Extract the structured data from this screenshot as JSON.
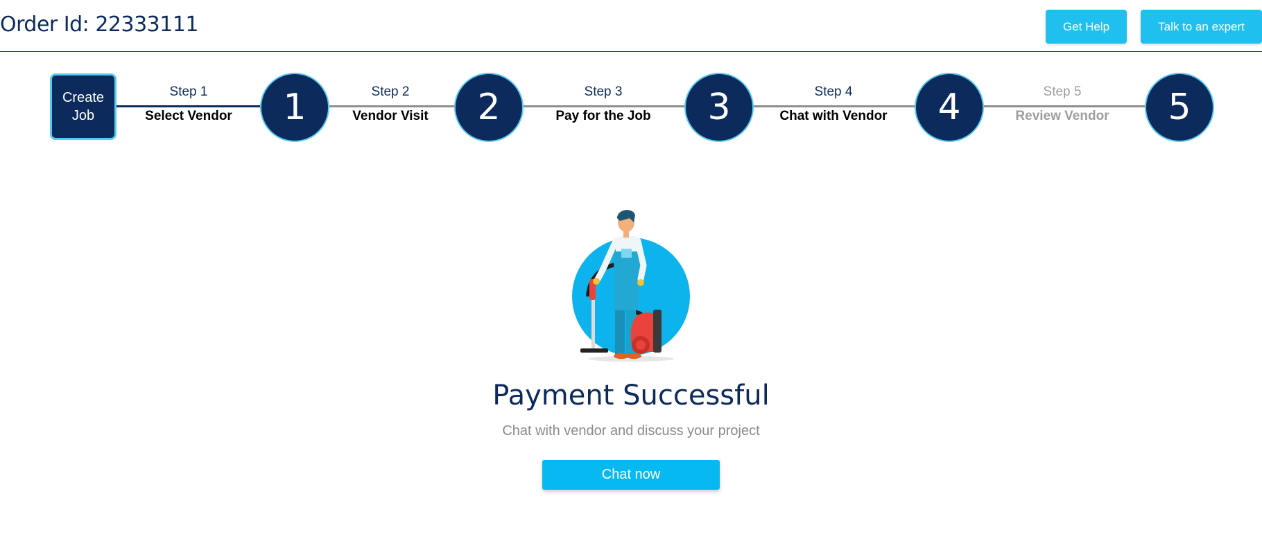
{
  "header": {
    "order_id": "Order Id: 22333111",
    "get_help_label": "Get Help",
    "talk_expert_label": "Talk to an expert"
  },
  "stepper": {
    "create_job_label": "Create Job",
    "steps": [
      {
        "step": "Step 1",
        "name": "Select Vendor",
        "number": "1"
      },
      {
        "step": "Step 2",
        "name": "Vendor Visit",
        "number": "2"
      },
      {
        "step": "Step 3",
        "name": "Pay for the Job",
        "number": "3"
      },
      {
        "step": "Step 4",
        "name": "Chat with Vendor",
        "number": "4"
      },
      {
        "step": "Step 5",
        "name": "Review Vendor",
        "number": "5"
      }
    ]
  },
  "main": {
    "title": "Payment Successful",
    "subtitle": "Chat with vendor and discuss your project",
    "chat_button_label": "Chat now"
  },
  "colors": {
    "navy": "#0c2a5b",
    "accent": "#1fc0f0",
    "disabled": "#9e9e9e"
  }
}
